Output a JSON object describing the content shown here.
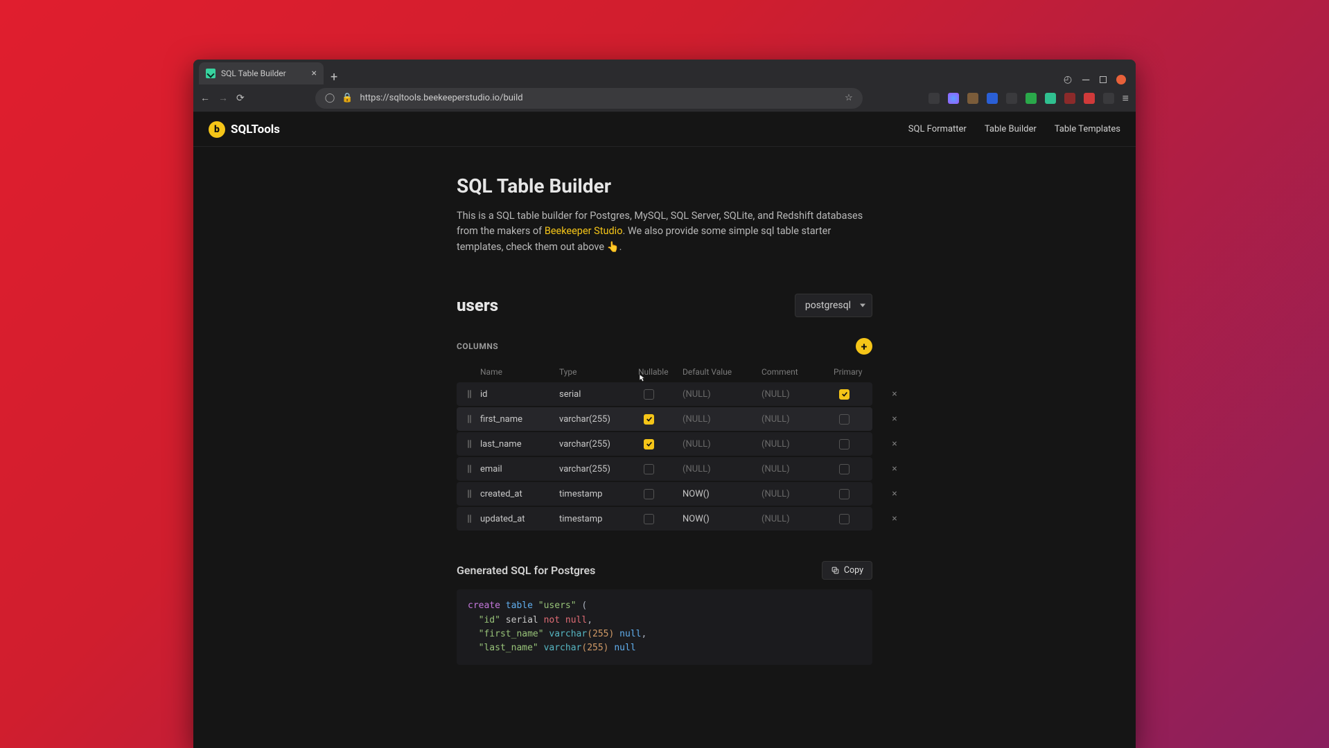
{
  "browser": {
    "tab_title": "SQL Table Builder",
    "url": "https://sqltools.beekeeperstudio.io/build"
  },
  "site": {
    "brand": "SQLTools",
    "nav": [
      "SQL Formatter",
      "Table Builder",
      "Table Templates"
    ]
  },
  "page": {
    "title": "SQL Table Builder",
    "intro_1": "This is a SQL table builder for Postgres, MySQL, SQL Server, SQLite, and Redshift databases from the makers of ",
    "intro_link": "Beekeeper Studio",
    "intro_2": ". We also provide some simple sql table starter templates, check them out above 👆."
  },
  "builder": {
    "table_name": "users",
    "db_engine": "postgresql",
    "columns_label": "COLUMNS",
    "headers": {
      "name": "Name",
      "type": "Type",
      "nullable": "Nullable",
      "default": "Default Value",
      "comment": "Comment",
      "primary": "Primary"
    },
    "rows": [
      {
        "name": "id",
        "type": "serial",
        "nullable": false,
        "default": "(NULL)",
        "comment": "(NULL)",
        "primary": true
      },
      {
        "name": "first_name",
        "type": "varchar(255)",
        "nullable": true,
        "default": "(NULL)",
        "comment": "(NULL)",
        "primary": false
      },
      {
        "name": "last_name",
        "type": "varchar(255)",
        "nullable": true,
        "default": "(NULL)",
        "comment": "(NULL)",
        "primary": false
      },
      {
        "name": "email",
        "type": "varchar(255)",
        "nullable": false,
        "default": "(NULL)",
        "comment": "(NULL)",
        "primary": false
      },
      {
        "name": "created_at",
        "type": "timestamp",
        "nullable": false,
        "default": "NOW()",
        "comment": "(NULL)",
        "primary": false
      },
      {
        "name": "updated_at",
        "type": "timestamp",
        "nullable": false,
        "default": "NOW()",
        "comment": "(NULL)",
        "primary": false
      }
    ]
  },
  "generated": {
    "title": "Generated SQL for Postgres",
    "copy_label": "Copy"
  },
  "sql": {
    "l1_create": "create",
    "l1_table": "table",
    "l1_name": "\"users\"",
    "l1_paren": "(",
    "l2_name": "\"id\"",
    "l2_type": "serial",
    "l2_not": "not",
    "l2_null": "null",
    "l2_comma": ",",
    "l3_name": "\"first_name\"",
    "l3_type": "varchar",
    "l3_arg": "(255)",
    "l3_null": "null",
    "l3_comma": ",",
    "l4_name": "\"last_name\"",
    "l4_type": "varchar",
    "l4_arg": "(255)",
    "l4_null": "null"
  },
  "null_placeholder": "(NULL)"
}
